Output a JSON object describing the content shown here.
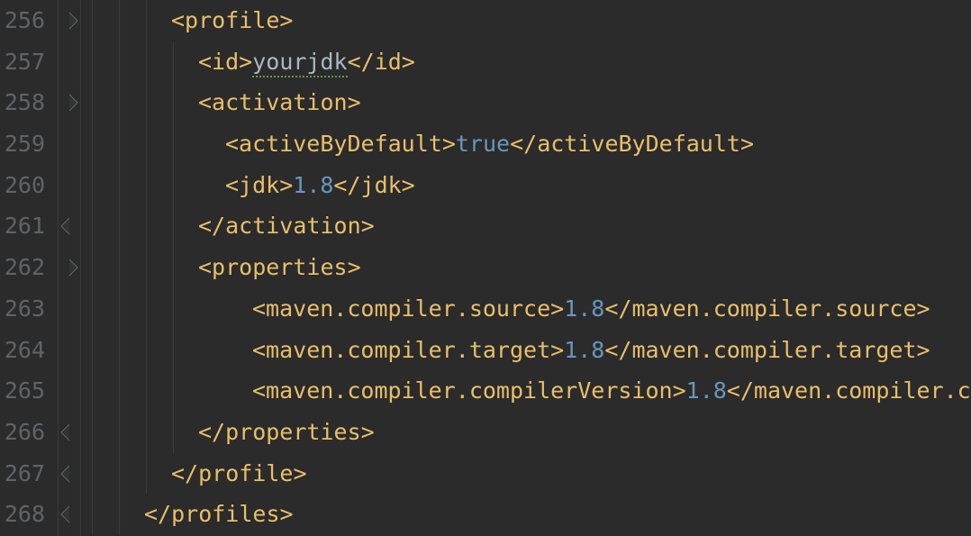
{
  "lines": [
    {
      "num": "256",
      "indent": 3,
      "fold": "open",
      "segs": [
        {
          "t": "tag",
          "v": "<profile>"
        }
      ]
    },
    {
      "num": "257",
      "indent": 4,
      "fold": "",
      "segs": [
        {
          "t": "tag",
          "v": "<id>"
        },
        {
          "t": "txt",
          "v": "yourjdk",
          "ul": true
        },
        {
          "t": "tag",
          "v": "</id>"
        }
      ]
    },
    {
      "num": "258",
      "indent": 4,
      "fold": "open",
      "segs": [
        {
          "t": "tag",
          "v": "<activation>"
        }
      ]
    },
    {
      "num": "259",
      "indent": 5,
      "fold": "",
      "segs": [
        {
          "t": "tag",
          "v": "<activeByDefault>"
        },
        {
          "t": "val-blue",
          "v": "true"
        },
        {
          "t": "tag",
          "v": "</activeByDefault>"
        }
      ]
    },
    {
      "num": "260",
      "indent": 5,
      "fold": "",
      "segs": [
        {
          "t": "tag",
          "v": "<jdk>"
        },
        {
          "t": "val-blue",
          "v": "1.8"
        },
        {
          "t": "tag",
          "v": "</jdk>"
        }
      ]
    },
    {
      "num": "261",
      "indent": 4,
      "fold": "close",
      "segs": [
        {
          "t": "tag",
          "v": "</activation>"
        }
      ]
    },
    {
      "num": "262",
      "indent": 4,
      "fold": "open",
      "segs": [
        {
          "t": "tag",
          "v": "<properties>"
        }
      ]
    },
    {
      "num": "263",
      "indent": 6,
      "fold": "",
      "segs": [
        {
          "t": "tag",
          "v": "<maven.compiler.source>"
        },
        {
          "t": "val-blue",
          "v": "1.8"
        },
        {
          "t": "tag",
          "v": "</maven.compiler.source>"
        }
      ]
    },
    {
      "num": "264",
      "indent": 6,
      "fold": "",
      "segs": [
        {
          "t": "tag",
          "v": "<maven.compiler.target>"
        },
        {
          "t": "val-blue",
          "v": "1.8"
        },
        {
          "t": "tag",
          "v": "</maven.compiler.target>"
        }
      ]
    },
    {
      "num": "265",
      "indent": 6,
      "fold": "",
      "segs": [
        {
          "t": "tag",
          "v": "<maven.compiler.compilerVersion>"
        },
        {
          "t": "val-blue",
          "v": "1.8"
        },
        {
          "t": "tag",
          "v": "</maven.compiler.compilerVersion>"
        }
      ]
    },
    {
      "num": "266",
      "indent": 4,
      "fold": "close",
      "segs": [
        {
          "t": "tag",
          "v": "</properties>"
        }
      ]
    },
    {
      "num": "267",
      "indent": 3,
      "fold": "close",
      "segs": [
        {
          "t": "tag",
          "v": "</profile>"
        }
      ]
    },
    {
      "num": "268",
      "indent": 2,
      "fold": "close",
      "segs": [
        {
          "t": "tag",
          "v": "</profiles>"
        }
      ]
    }
  ],
  "guides": [
    1,
    2,
    3,
    4
  ],
  "colors": {
    "bg": "#2b2b2b",
    "gutter_fg": "#606366",
    "tag": "#e8bf6a",
    "text": "#a9b7c6",
    "value": "#6897bb",
    "underline": "#629755"
  }
}
